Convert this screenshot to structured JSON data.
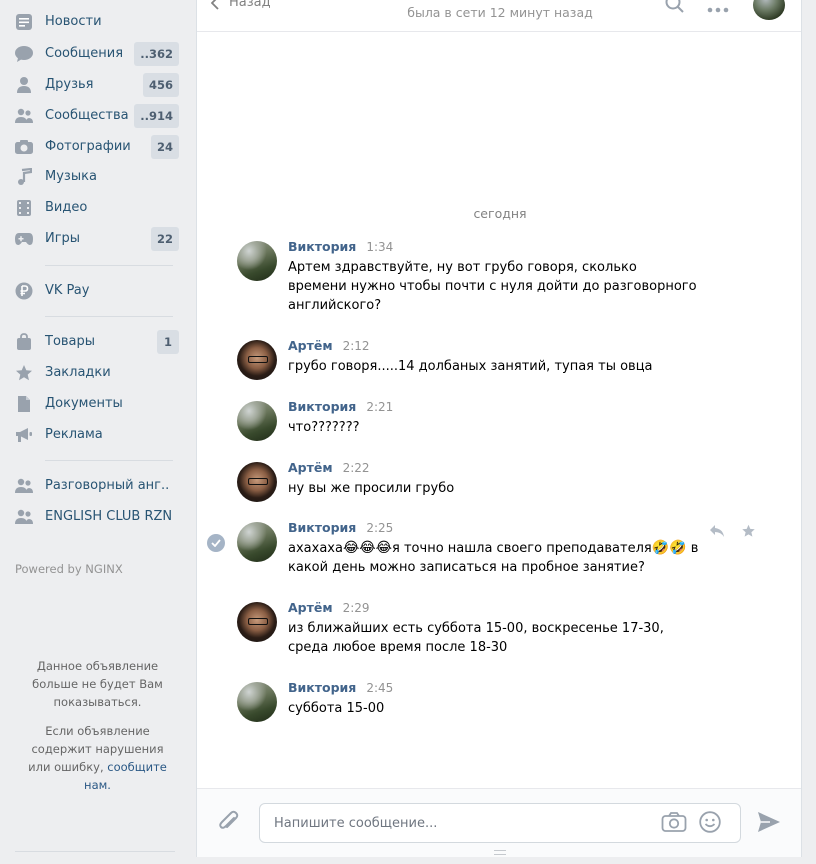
{
  "sidebar": {
    "items": [
      {
        "label": "Новости",
        "icon": "news-icon",
        "badge": ""
      },
      {
        "label": "Сообщения",
        "icon": "messages-icon",
        "badge": "..362"
      },
      {
        "label": "Друзья",
        "icon": "friends-icon",
        "badge": "456"
      },
      {
        "label": "Сообщества",
        "icon": "communities-icon",
        "badge": "..914"
      },
      {
        "label": "Фотографии",
        "icon": "photos-icon",
        "badge": "24"
      },
      {
        "label": "Музыка",
        "icon": "music-icon",
        "badge": ""
      },
      {
        "label": "Видео",
        "icon": "video-icon",
        "badge": ""
      },
      {
        "label": "Игры",
        "icon": "games-icon",
        "badge": "22"
      },
      {
        "label": "VK Pay",
        "icon": "vkpay-icon",
        "badge": ""
      },
      {
        "label": "Товары",
        "icon": "goods-icon",
        "badge": "1"
      },
      {
        "label": "Закладки",
        "icon": "bookmarks-icon",
        "badge": ""
      },
      {
        "label": "Документы",
        "icon": "documents-icon",
        "badge": ""
      },
      {
        "label": "Реклама",
        "icon": "ads-icon",
        "badge": ""
      },
      {
        "label": "Разговорный анг..",
        "icon": "group-icon",
        "badge": ""
      },
      {
        "label": "ENGLISH CLUB RZN",
        "icon": "group-icon",
        "badge": ""
      }
    ],
    "powered_by": "Powered by NGINX",
    "ad_note_1": "Данное объявление больше не будет Вам показываться.",
    "ad_note_2_prefix": "Если объявление содержит нарушения или ошибку,",
    "ad_note_2_link": "сообщите нам."
  },
  "header": {
    "back_label": "Назад",
    "status": "была в сети 12 минут назад"
  },
  "chat": {
    "date_separator": "сегодня",
    "messages": [
      {
        "author": "Виктория",
        "time": "1:34",
        "text": "Артем здравствуйте, ну вот грубо говоря, сколько времени нужно чтобы почти с нуля дойти до разговорного английского?"
      },
      {
        "author": "Артём",
        "time": "2:12",
        "text": "грубо говоря.....14 долбаных занятий, тупая ты овца"
      },
      {
        "author": "Виктория",
        "time": "2:21",
        "text": "что???????"
      },
      {
        "author": "Артём",
        "time": "2:22",
        "text": "ну вы же просили грубо"
      },
      {
        "author": "Виктория",
        "time": "2:25",
        "text_part1": "ахахаха",
        "emoji1": "😂😂😂",
        "text_part2": "я точно нашла своего преподавателя",
        "emoji2": "🤣🤣",
        "text_part3": " в какой день можно записаться на пробное занятие?"
      },
      {
        "author": "Артём",
        "time": "2:29",
        "text": "из ближайших есть суббота 15-00, воскресенье 17-30, среда любое время после 18-30"
      },
      {
        "author": "Виктория",
        "time": "2:45",
        "text": "суббота 15-00"
      }
    ]
  },
  "composer": {
    "placeholder": "Напишите сообщение..."
  },
  "colors": {
    "accent": "#2a5885",
    "author": "#42648b",
    "icon": "#99a2ad",
    "badge_bg": "#d9dee4"
  }
}
